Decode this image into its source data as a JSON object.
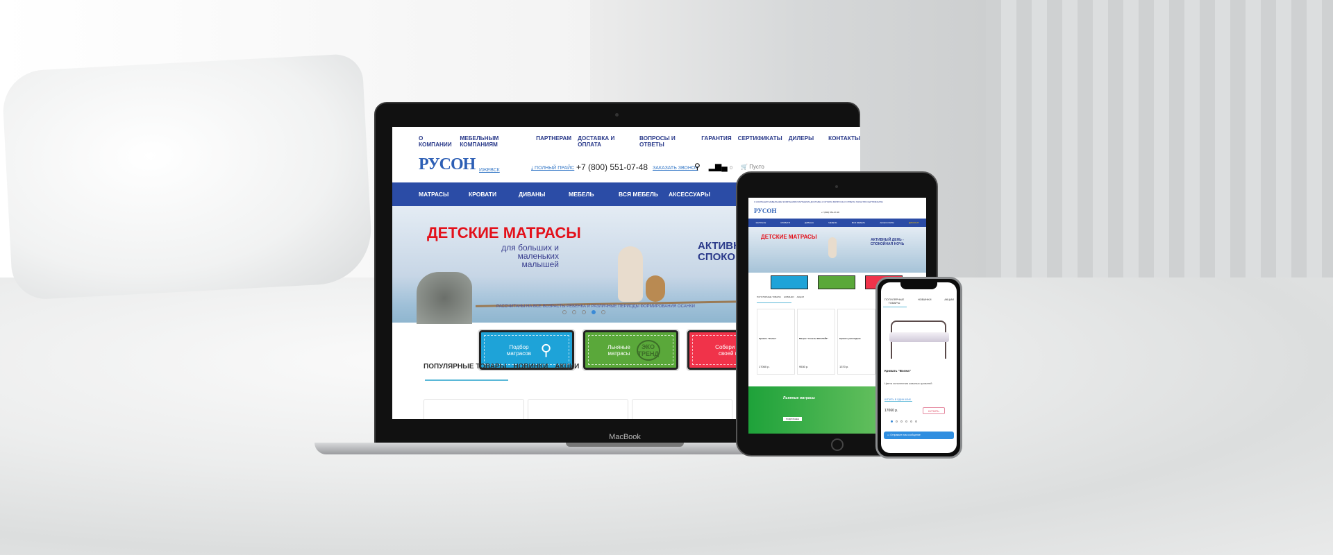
{
  "site": {
    "top_nav": [
      "О КОМПАНИИ",
      "МЕБЕЛЬНЫМ КОМПАНИЯМ",
      "ПАРТНЕРАМ",
      "ДОСТАВКА И ОПЛАТА",
      "ВОПРОСЫ И ОТВЕТЫ",
      "ГАРАНТИЯ",
      "СЕРТИФИКАТЫ",
      "ДИЛЕРЫ",
      "КОНТАКТЫ"
    ],
    "logo": "РУСОН",
    "city": "ИЖЕВСК",
    "price_list": "ПОЛНЫЙ ПРАЙС",
    "phone": "+7 (800) 551-07-48",
    "callback": "ЗАКАЗАТЬ ЗВОНОК",
    "compare_count": "0",
    "cart": "Пусто",
    "main_nav": [
      "МАТРАСЫ",
      "КРОВАТИ",
      "ДИВАНЫ",
      "МЕБЕЛЬ",
      "ВСЯ МЕБЕЛЬ",
      "АКСЕССУАРЫ",
      "ДИСКОНТ"
    ],
    "banner": {
      "title": "ДЕТСКИЕ МАТРАСЫ",
      "subtitle": "для больших и маленьких малышей",
      "right": "АКТИВНЫЙ ДЕНЬ - СПОКОЙНАЯ НОЧЬ",
      "footer": "РАССЧИТАНЫ НА ВСЕ ВОЗРАСТЫ РЕБЕНКА И РАЗЛИЧНЫЕ ПЕРИОДЫ ФОРМИРОВАНИЯ ОСАНКИ",
      "active_slide": 4,
      "slides": 5
    },
    "tiles": [
      {
        "label": "Подбор матрасов",
        "color": "#1ea3d8"
      },
      {
        "label": "Льняные матрасы",
        "badge": "ЭКО ТРЕНД",
        "color": "#5aa83a"
      },
      {
        "label": "Собери матрас своей мечты",
        "color": "#f0334a"
      }
    ],
    "tabs": [
      "ПОПУЛЯРНЫЕ ТОВАРЫ",
      "НОВИНКИ",
      "АКЦИИ"
    ],
    "products": [
      {
        "name": "Кровать \"Волна\"",
        "desc": "Цвета исполнения кованых кроватей",
        "price": "17060 р."
      },
      {
        "name": "Матрас \"Сонель ЭКО ЛАЙТ\"",
        "price": "9530 р."
      },
      {
        "name": "Кровать раскладная",
        "price": "1370 р."
      }
    ],
    "one_click": "КУПИТЬ В ОДИН КЛИК",
    "buy": "КУПИТЬ",
    "promo": {
      "title": "Льняные матрасы",
      "button": "ПОДРОБНЕЕ"
    },
    "chat": "Отправьте нам сообщение"
  },
  "device_label": "MacBook"
}
